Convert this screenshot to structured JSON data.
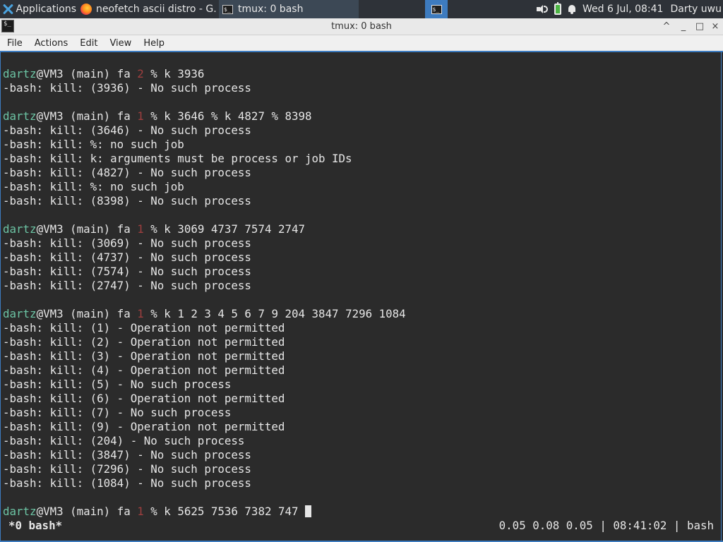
{
  "panel": {
    "apps_label": "Applications",
    "tasks": [
      {
        "label": "neofetch ascii distro - G...",
        "icon": "firefox-icon"
      },
      {
        "label": "tmux: 0 bash",
        "icon": "terminal-icon"
      }
    ],
    "clock": "Wed  6 Jul, 08:41",
    "user": "Darty uwu"
  },
  "window": {
    "title": "tmux: 0 bash",
    "controls": [
      "^",
      "_",
      "□",
      "×"
    ]
  },
  "menu": [
    "File",
    "Actions",
    "Edit",
    "View",
    "Help"
  ],
  "terminal": {
    "prompt": {
      "user": "dartz",
      "host": "@VM3 (main) fa "
    },
    "commands": [
      {
        "jobs": "2",
        "cmd": "k 3936"
      },
      {
        "jobs": "1",
        "cmd": "k 3646 % k 4827 % 8398"
      },
      {
        "jobs": "1",
        "cmd": "k 3069 4737 7574 2747"
      },
      {
        "jobs": "1",
        "cmd": "k 1 2 3 4 5 6 7 9 204 3847 7296 1084"
      },
      {
        "jobs": "1",
        "cmd": "k 5625 7536 7382 747 "
      }
    ],
    "outputs": [
      [
        "-bash: kill: (3936) - No such process"
      ],
      [
        "-bash: kill: (3646) - No such process",
        "-bash: kill: %: no such job",
        "-bash: kill: k: arguments must be process or job IDs",
        "-bash: kill: (4827) - No such process",
        "-bash: kill: %: no such job",
        "-bash: kill: (8398) - No such process"
      ],
      [
        "-bash: kill: (3069) - No such process",
        "-bash: kill: (4737) - No such process",
        "-bash: kill: (7574) - No such process",
        "-bash: kill: (2747) - No such process"
      ],
      [
        "-bash: kill: (1) - Operation not permitted",
        "-bash: kill: (2) - Operation not permitted",
        "-bash: kill: (3) - Operation not permitted",
        "-bash: kill: (4) - Operation not permitted",
        "-bash: kill: (5) - No such process",
        "-bash: kill: (6) - Operation not permitted",
        "-bash: kill: (7) - No such process",
        "-bash: kill: (9) - Operation not permitted",
        "-bash: kill: (204) - No such process",
        "-bash: kill: (3847) - No such process",
        "-bash: kill: (7296) - No such process",
        "-bash: kill: (1084) - No such process"
      ]
    ]
  },
  "status": {
    "left": "*0 bash*",
    "right": "0.05 0.08 0.05 | 08:41:02 | bash"
  },
  "colors": {
    "user": "#6cc4a4",
    "jobs": "#9e3f3f",
    "accent": "#3d7bbf",
    "terminal_bg": "#2b2b2b"
  }
}
